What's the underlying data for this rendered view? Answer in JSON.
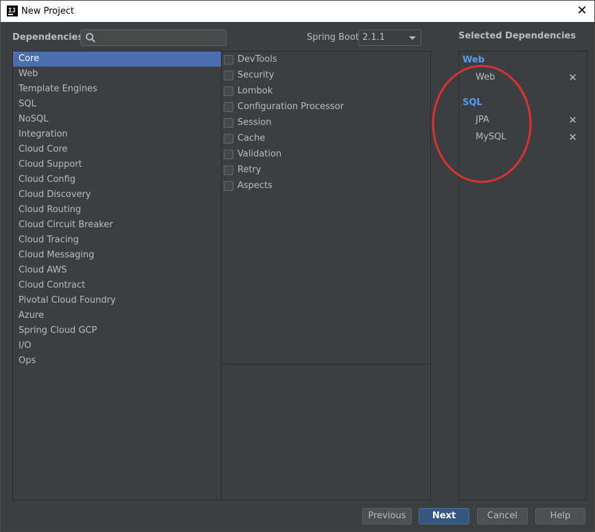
{
  "window": {
    "title": "New Project",
    "app_icon_text": "IJ"
  },
  "header": {
    "dependencies_label": "Dependencies",
    "search": {
      "value": "",
      "placeholder": ""
    },
    "spring_boot_label": "Spring Boot",
    "spring_boot_version": "2.1.1",
    "selected_header": "Selected Dependencies"
  },
  "categories": [
    "Core",
    "Web",
    "Template Engines",
    "SQL",
    "NoSQL",
    "Integration",
    "Cloud Core",
    "Cloud Support",
    "Cloud Config",
    "Cloud Discovery",
    "Cloud Routing",
    "Cloud Circuit Breaker",
    "Cloud Tracing",
    "Cloud Messaging",
    "Cloud AWS",
    "Cloud Contract",
    "Pivotal Cloud Foundry",
    "Azure",
    "Spring Cloud GCP",
    "I/O",
    "Ops"
  ],
  "selected_category": "Core",
  "dependencies": [
    "DevTools",
    "Security",
    "Lombok",
    "Configuration Processor",
    "Session",
    "Cache",
    "Validation",
    "Retry",
    "Aspects"
  ],
  "selected": {
    "groups": [
      {
        "name": "Web",
        "items": [
          "Web"
        ]
      },
      {
        "name": "SQL",
        "items": [
          "JPA",
          "MySQL"
        ]
      }
    ],
    "remove_glyph": "✕"
  },
  "buttons": {
    "previous": "Previous",
    "next": "Next",
    "cancel": "Cancel",
    "help": "Help"
  },
  "colors": {
    "accent": "#4b6eaf",
    "group": "#589df6",
    "annotation": "#e03030"
  }
}
